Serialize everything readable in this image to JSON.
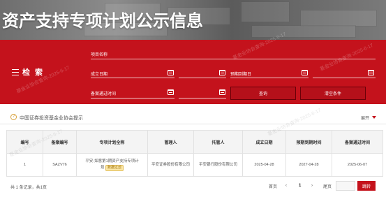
{
  "banner": {
    "title": "资产支持专项计划公示信息"
  },
  "search": {
    "label": "检 索",
    "fields": {
      "asset_name": "项目名称",
      "start_date": "成立日期",
      "expiry_date": "预期到期日",
      "record_date": "备案通过时间"
    },
    "buttons": {
      "query": "查询",
      "clear": "清空条件"
    }
  },
  "info": {
    "text": "中国证券投资基金业协会提示",
    "expand": "展开"
  },
  "table": {
    "headers": [
      "编号",
      "备案编号",
      "专项计划全称",
      "管理人",
      "托管人",
      "成立日期",
      "预期到期时间",
      "备案通过时间"
    ],
    "rows": [
      {
        "no": "1",
        "record_no": "SAZV76",
        "name_line1": "平安-如意第1期资产支持专项计",
        "name_line2": "划",
        "tag": "数据过滤",
        "manager": "平安证券股份有限公司",
        "custodian": "平安银行股份有限公司",
        "start": "2025-04-28",
        "expiry": "2027-04-28",
        "record_time": "2025-06-07"
      }
    ]
  },
  "footer": {
    "total": "共 1 条记录，共1页",
    "first": "首页",
    "prev": "‹",
    "page": "1",
    "next": "›",
    "last": "尾页",
    "goto": "跳转"
  },
  "watermark": "基金业协会查询-2025-6-17",
  "chart_data": {
    "type": "table",
    "columns": [
      "编号",
      "备案编号",
      "专项计划全称",
      "管理人",
      "托管人",
      "成立日期",
      "预期到期时间",
      "备案通过时间"
    ],
    "rows": [
      [
        "1",
        "SAZV76",
        "平安-如意第1期资产支持专项计划",
        "平安证券股份有限公司",
        "平安银行股份有限公司",
        "2025-04-28",
        "2027-04-28",
        "2025-06-07"
      ]
    ]
  }
}
